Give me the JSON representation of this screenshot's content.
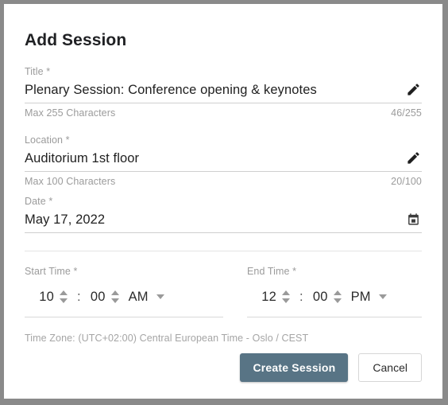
{
  "dialog": {
    "title": "Add Session"
  },
  "fields": {
    "title": {
      "label": "Title *",
      "value": "Plenary Session: Conference opening & keynotes",
      "helper": "Max 255 Characters",
      "counter": "46/255",
      "edit_icon": "pencil-icon"
    },
    "location": {
      "label": "Location *",
      "value": "Auditorium 1st floor",
      "helper": "Max 100 Characters",
      "counter": "20/100",
      "edit_icon": "pencil-icon"
    },
    "date": {
      "label": "Date *",
      "value": "May 17, 2022",
      "picker_icon": "calendar-icon"
    }
  },
  "start_time": {
    "label": "Start Time *",
    "hour": "10",
    "separator": ":",
    "minute": "00",
    "meridiem": "AM"
  },
  "end_time": {
    "label": "End Time *",
    "hour": "12",
    "separator": ":",
    "minute": "00",
    "meridiem": "PM"
  },
  "timezone": "Time Zone: (UTC+02:00) Central European Time - Oslo / CEST",
  "buttons": {
    "primary": "Create Session",
    "secondary": "Cancel"
  },
  "colors": {
    "primary_button": "#587485",
    "frame": "#8a8a8a",
    "label_text": "#9b9b9b",
    "value_text": "#212121"
  }
}
